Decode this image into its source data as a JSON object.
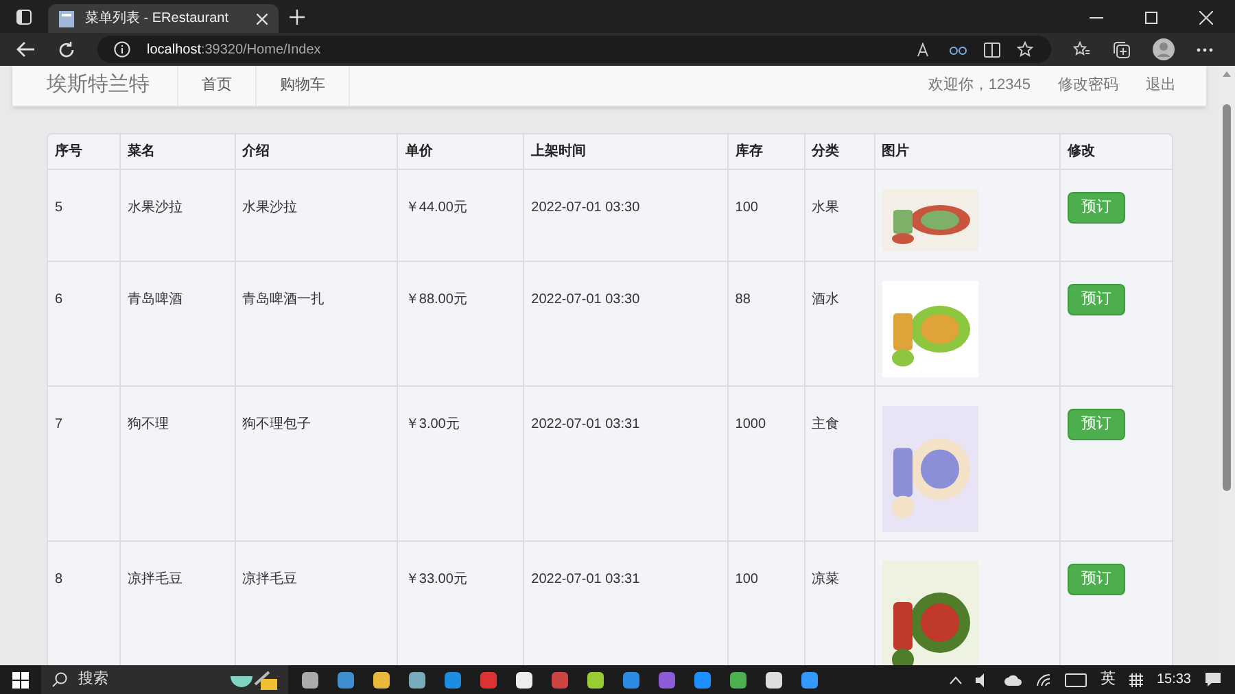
{
  "browser": {
    "tab_title": "菜单列表 - ERestaurant",
    "url_host": "localhost",
    "url_rest": ":39320/Home/Index"
  },
  "navbar": {
    "brand": "埃斯特兰特",
    "links": [
      "首页",
      "购物车"
    ],
    "welcome": "欢迎你，12345",
    "change_password": "修改密码",
    "logout": "退出"
  },
  "table": {
    "columns": [
      "序号",
      "菜名",
      "介绍",
      "单价",
      "上架时间",
      "库存",
      "分类",
      "图片",
      "修改"
    ],
    "rows": [
      {
        "id": "5",
        "name": "水果沙拉",
        "intro": "水果沙拉",
        "price": "￥44.00元",
        "time": "2022-07-01 03:30",
        "stock": "100",
        "category": "水果",
        "button": "预订"
      },
      {
        "id": "6",
        "name": "青岛啤酒",
        "intro": "青岛啤酒一扎",
        "price": "￥88.00元",
        "time": "2022-07-01 03:30",
        "stock": "88",
        "category": "酒水",
        "button": "预订"
      },
      {
        "id": "7",
        "name": "狗不理",
        "intro": "狗不理包子",
        "price": "￥3.00元",
        "time": "2022-07-01 03:31",
        "stock": "1000",
        "category": "主食",
        "button": "预订"
      },
      {
        "id": "8",
        "name": "凉拌毛豆",
        "intro": "凉拌毛豆",
        "price": "￥33.00元",
        "time": "2022-07-01 03:31",
        "stock": "100",
        "category": "凉菜",
        "button": "预订"
      }
    ]
  },
  "taskbar": {
    "search": "搜索",
    "ime": "英",
    "time": "15:33"
  }
}
